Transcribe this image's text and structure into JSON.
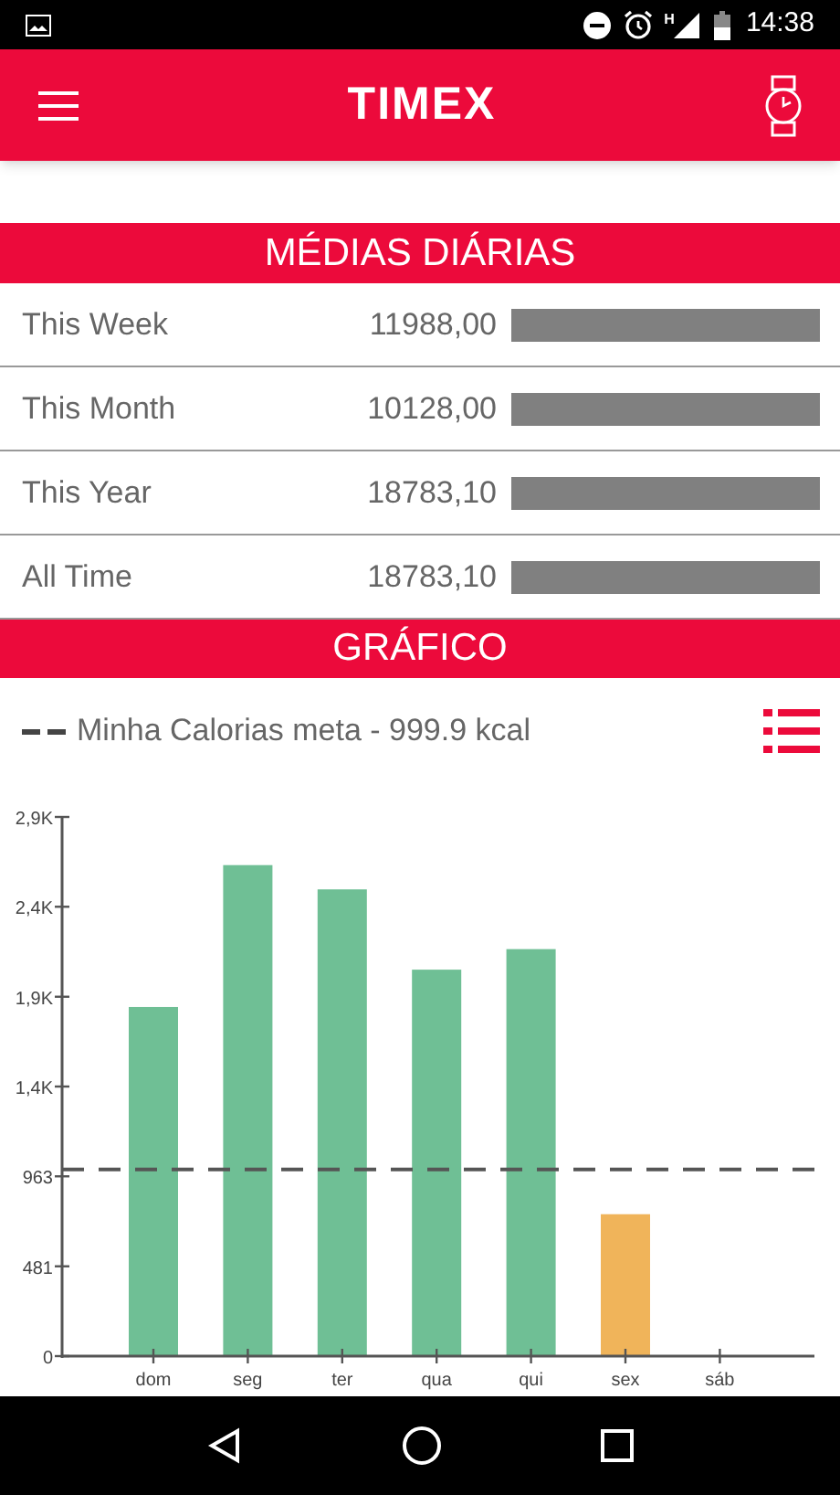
{
  "status_bar": {
    "time": "14:38",
    "network_label": "H"
  },
  "app_bar": {
    "title": "TIMEX"
  },
  "daily_averages": {
    "title": "MÉDIAS DIÁRIAS",
    "rows": [
      {
        "label": "This Week",
        "value": "11988,00",
        "level": 1
      },
      {
        "label": "This Month",
        "value": "10128,00",
        "level": 1
      },
      {
        "label": "This Year",
        "value": "18783,10",
        "level": 1
      },
      {
        "label": "All Time",
        "value": "18783,10",
        "level": 1
      }
    ]
  },
  "chart_section": {
    "title": "GRÁFICO",
    "legend": "Minha Calorias meta - 999.9 kcal",
    "chart_data": {
      "type": "bar",
      "categories": [
        "dom",
        "seg",
        "ter",
        "qua",
        "qui",
        "sex",
        "sáb"
      ],
      "stacked": true,
      "series": [
        {
          "color": "#6fbf95",
          "values": [
            1870,
            2630,
            2500,
            2070,
            2180,
            null,
            0
          ]
        },
        {
          "color": "#f0b45a",
          "values": [
            null,
            null,
            null,
            null,
            null,
            760,
            null
          ]
        }
      ],
      "ylim": [
        0,
        2888
      ],
      "yticks": [
        0,
        481,
        963,
        {
          "value": 1444,
          "label": "1,4K"
        },
        {
          "value": 1925,
          "label": "1,9K"
        },
        {
          "value": 2407,
          "label": "2,4K"
        },
        {
          "value": 2888,
          "label": "2,9K"
        }
      ],
      "ref_lines": [
        {
          "axis": "y",
          "value": 999.9
        }
      ]
    }
  }
}
